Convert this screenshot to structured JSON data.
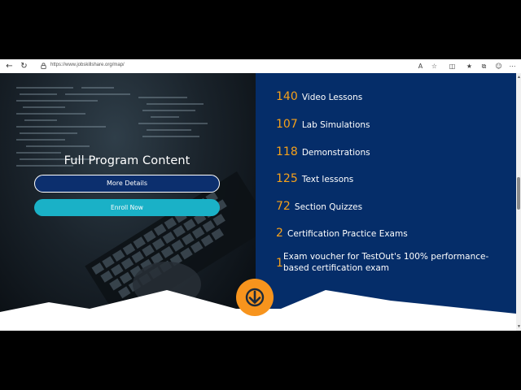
{
  "browser": {
    "url": "https://www.jobskillshare.org/map/",
    "icons": [
      "back-icon",
      "reload-icon",
      "lock-icon",
      "read-aloud-icon",
      "favorite-icon",
      "split-screen-icon",
      "favorites-bar-icon",
      "collections-icon",
      "profile-icon",
      "more-icon"
    ]
  },
  "hero": {
    "title": "Full Program Content",
    "more_details_label": "More Details",
    "enroll_label": "Enroll Now"
  },
  "features": [
    {
      "num": "140",
      "label": "Video Lessons"
    },
    {
      "num": "107",
      "label": "Lab Simulations"
    },
    {
      "num": "118",
      "label": "Demonstrations"
    },
    {
      "num": "125",
      "label": "Text lessons"
    },
    {
      "num": "72",
      "label": "Section Quizzes"
    },
    {
      "num": "2",
      "label": "Certification Practice Exams"
    },
    {
      "num": "1",
      "label": "Exam voucher for TestOut's 100% performance-based certification exam"
    }
  ],
  "colors": {
    "navy": "#052d69",
    "accent_orange": "#f7941d",
    "number_orange": "#f6a11a",
    "enroll_cyan": "#1ab1c7",
    "details_blue": "#0c2f6e"
  },
  "scroll_button_icon": "arrow-down-icon"
}
